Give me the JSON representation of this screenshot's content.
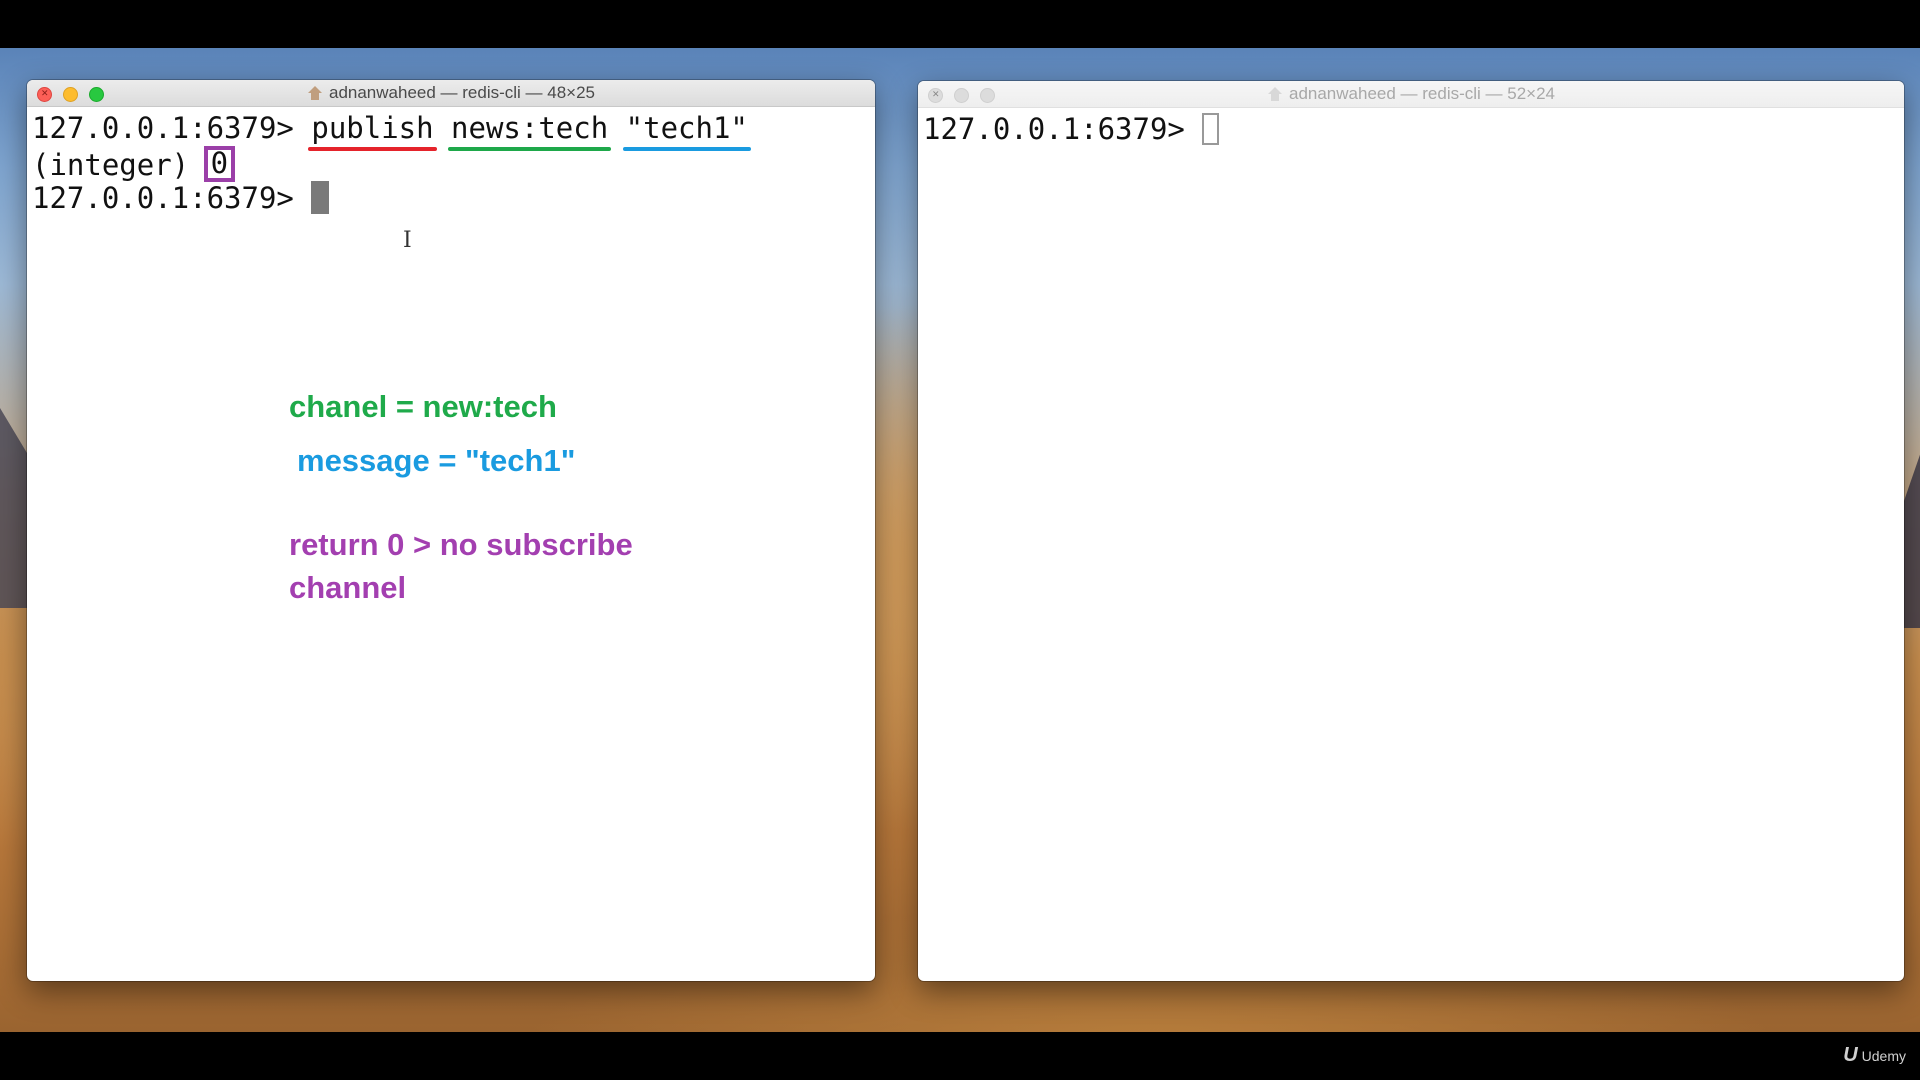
{
  "left_window": {
    "title": "adnanwaheed — redis-cli — 48×25",
    "lines": {
      "l1_prompt": "127.0.0.1:6379> ",
      "l1_cmd": "publish",
      "l1_channel": "news:tech",
      "l1_message": "\"tech1\"",
      "l2_type": "(integer) ",
      "l2_value": "0",
      "l3_prompt": "127.0.0.1:6379> "
    }
  },
  "right_window": {
    "title": "adnanwaheed — redis-cli — 52×24",
    "prompt": "127.0.0.1:6379> "
  },
  "annotations": {
    "channel": "chanel = new:tech",
    "message": "message = \"tech1\"",
    "return": "return 0 > no subscribe channel"
  },
  "watermark": {
    "mark": "U",
    "text": "Udemy"
  },
  "colors": {
    "underline_command": "#e5232b",
    "underline_channel": "#1ea84a",
    "underline_message": "#1a9be0",
    "return_box": "#9b3fa8"
  },
  "icons": [
    "home-icon",
    "close-icon",
    "ibeam-cursor-icon"
  ]
}
